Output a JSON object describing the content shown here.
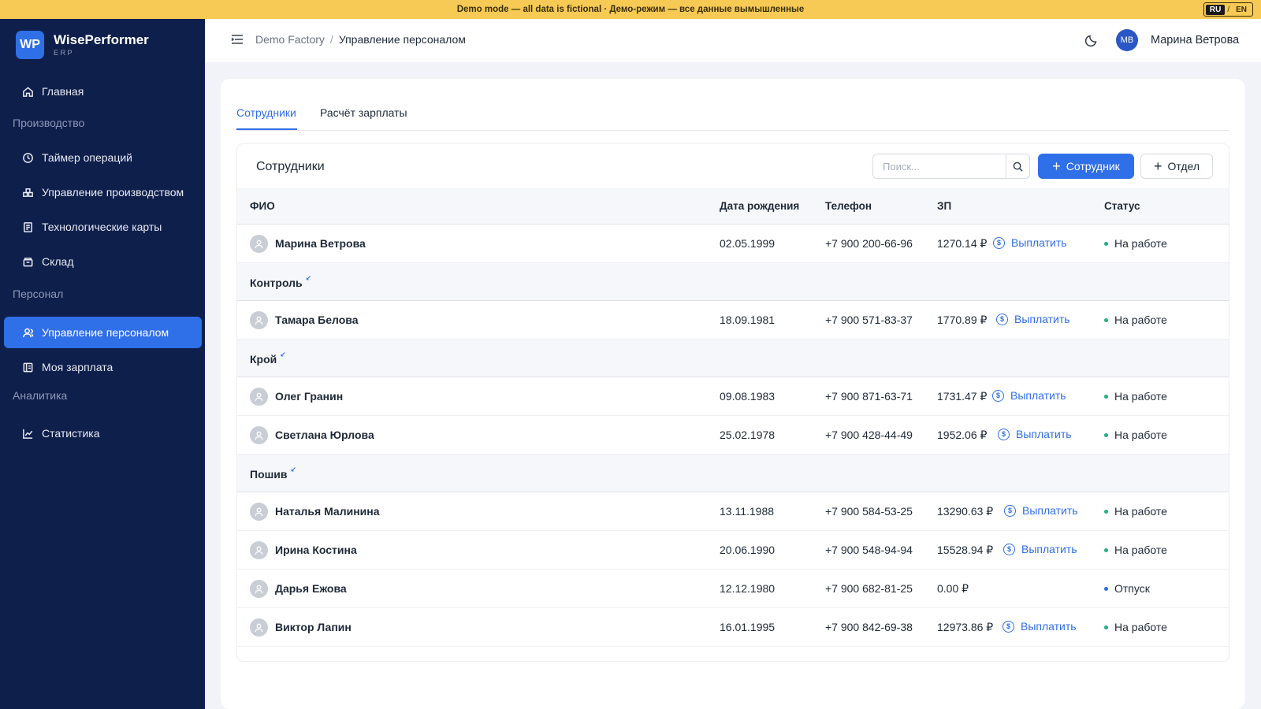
{
  "banner": {
    "text": "Demo mode — all data is fictional · Демо-режим — все данные вымышленные",
    "lang_ru": "RU",
    "lang_sep": "/",
    "lang_en": "EN"
  },
  "brand": {
    "initials": "WP",
    "name": "WisePerformer",
    "sub": "ERP"
  },
  "sidebar": {
    "home": "Главная",
    "section_production": "Производство",
    "timer": "Таймер операций",
    "production_mgmt": "Управление производством",
    "tech_cards": "Технологические карты",
    "warehouse": "Склад",
    "section_personnel": "Персонал",
    "personnel_mgmt": "Управление персоналом",
    "my_salary": "Моя зарплата",
    "section_analytics": "Аналитика",
    "statistics": "Статистика"
  },
  "header": {
    "crumb_root": "Demo Factory",
    "crumb_sep": "/",
    "crumb_current": "Управление персоналом",
    "user_initials": "МВ",
    "user_name": "Марина Ветрова"
  },
  "tabs": {
    "employees": "Сотрудники",
    "payroll": "Расчёт зарплаты"
  },
  "panel": {
    "title": "Сотрудники",
    "search_placeholder": "Поиск...",
    "add_employee": "Сотрудник",
    "add_dept": "Отдел"
  },
  "columns": {
    "name": "ФИО",
    "birth": "Дата рождения",
    "phone": "Телефон",
    "salary": "ЗП",
    "status": "Статус"
  },
  "pay_label": "Выплатить",
  "groups": {
    "control": "Контроль",
    "cutting": "Крой",
    "sewing": "Пошив"
  },
  "rows": [
    {
      "name": "Марина Ветрова",
      "birth": "02.05.1999",
      "phone": "+7 900 200-66-96",
      "salary": "1270.14 ₽",
      "status": "На работе"
    },
    {
      "name": "Тамара Белова",
      "birth": "18.09.1981",
      "phone": "+7 900 571-83-37",
      "salary": "1770.89 ₽",
      "status": "На работе"
    },
    {
      "name": "Олег Гранин",
      "birth": "09.08.1983",
      "phone": "+7 900 871-63-71",
      "salary": "1731.47 ₽",
      "status": "На работе"
    },
    {
      "name": "Светлана Юрлова",
      "birth": "25.02.1978",
      "phone": "+7 900 428-44-49",
      "salary": "1952.06 ₽",
      "status": "На работе"
    },
    {
      "name": "Наталья Малинина",
      "birth": "13.11.1988",
      "phone": "+7 900 584-53-25",
      "salary": "13290.63 ₽",
      "status": "На работе"
    },
    {
      "name": "Ирина Костина",
      "birth": "20.06.1990",
      "phone": "+7 900 548-94-94",
      "salary": "15528.94 ₽",
      "status": "На работе"
    },
    {
      "name": "Дарья Ежова",
      "birth": "12.12.1980",
      "phone": "+7 900 682-81-25",
      "salary": "0.00 ₽",
      "status": "Отпуск"
    },
    {
      "name": "Виктор Лапин",
      "birth": "16.01.1995",
      "phone": "+7 900 842-69-38",
      "salary": "12973.86 ₽",
      "status": "На работе"
    }
  ],
  "colors": {
    "accent": "#2f6fe8",
    "sidebar": "#0f1f4b",
    "banner": "#f6ca54",
    "status_work": "#22b07d",
    "status_vacation": "#2f6fe8"
  }
}
